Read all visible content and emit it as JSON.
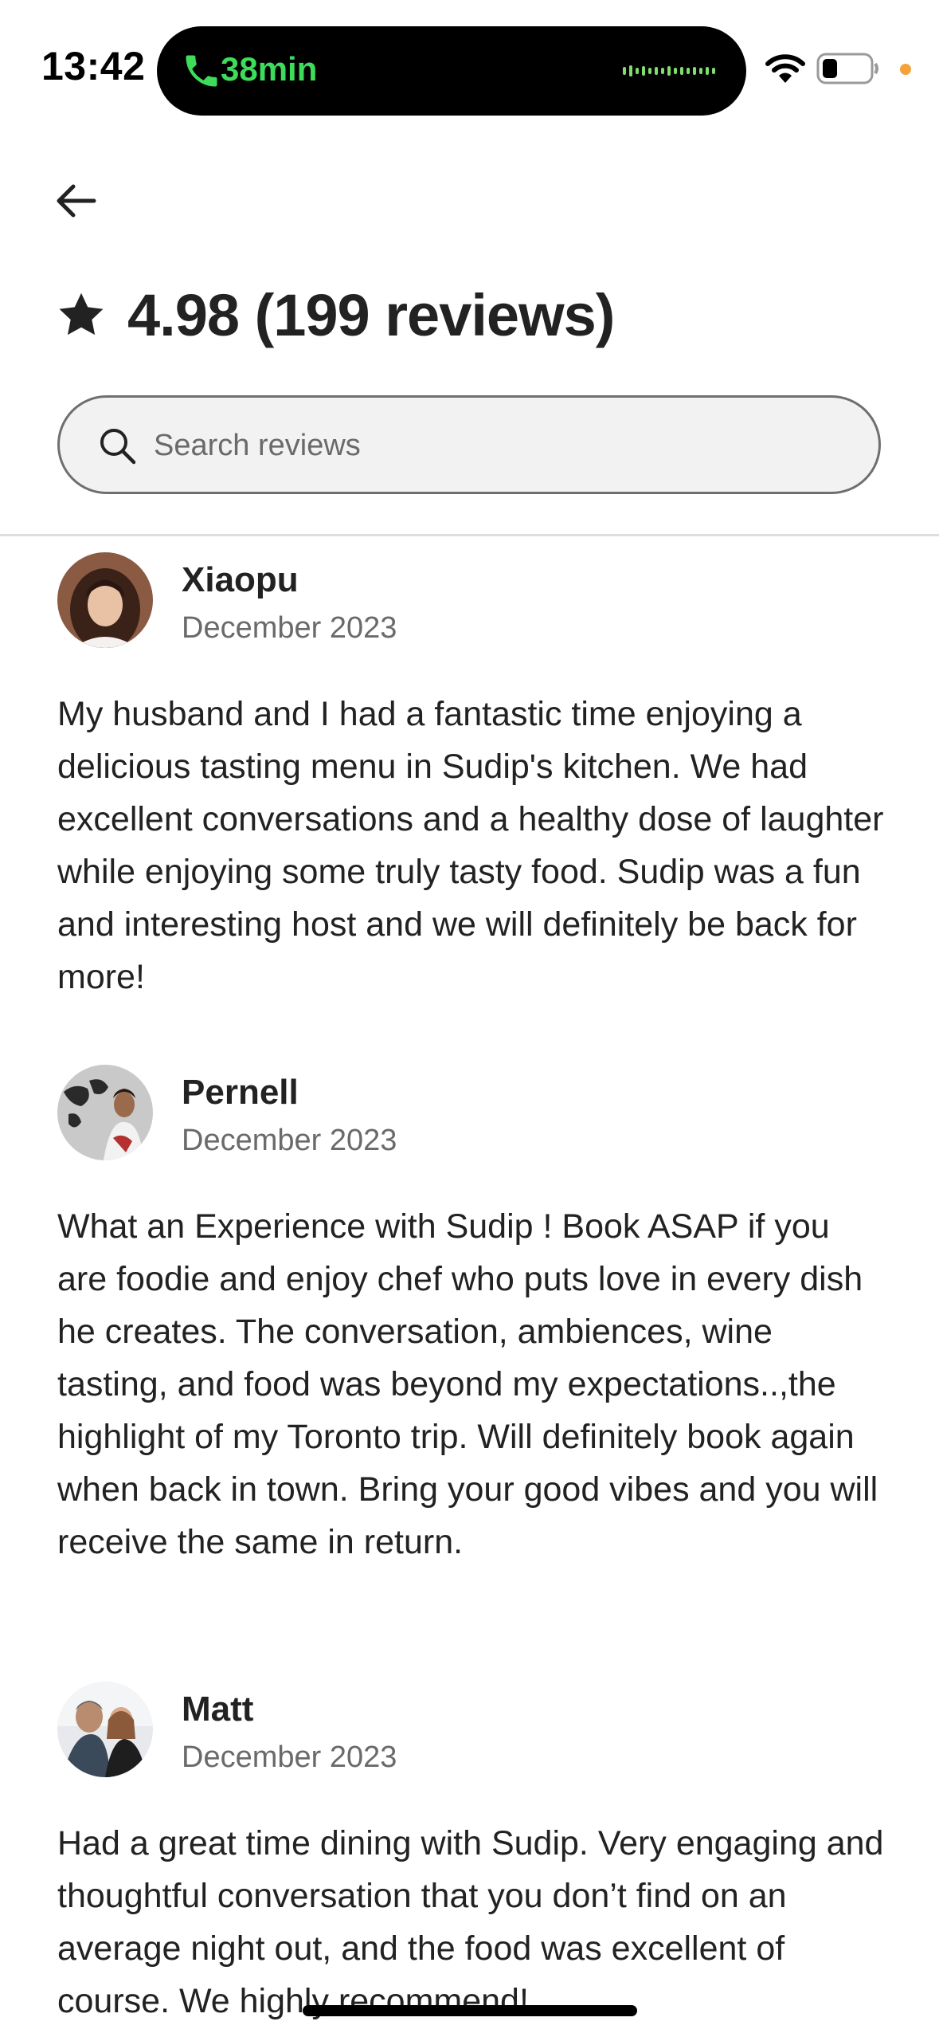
{
  "status_bar": {
    "time": "13:42",
    "call_duration": "38min",
    "call_color": "#3ddc5a"
  },
  "header": {
    "back_icon": "arrow-left-icon",
    "rating_icon": "star-icon",
    "rating_title": "4.98 (199 reviews)"
  },
  "search": {
    "icon": "search-icon",
    "placeholder": "Search reviews",
    "value": ""
  },
  "reviews": [
    {
      "name": "Xiaopu",
      "date": "December 2023",
      "text": "My husband and I had a fantastic time enjoying a delicious tasting menu in Sudip's kitchen. We had excellent conversations and a  healthy dose of laughter while enjoying some truly tasty food. Sudip was a fun and interesting host and we will definitely be back for more!"
    },
    {
      "name": "Pernell",
      "date": "December 2023",
      "text": "What an Experience with Sudip ! Book ASAP if you are foodie and enjoy chef who puts love in every dish he creates. The conversation, ambiences, wine tasting, and food was beyond my expectations..,the highlight of my Toronto trip. Will definitely book again when back in town. Bring your good vibes and you will receive the same in return."
    },
    {
      "name": "Matt",
      "date": "December 2023",
      "text": "Had a great time dining with Sudip.  Very engaging and thoughtful conversation that you don’t find on an average night out, and the food was excellent of course. We highly recommend!"
    }
  ],
  "colors": {
    "text_primary": "#222222",
    "text_secondary": "#6a6a6a",
    "search_background": "#f2f2f2",
    "divider": "#dddddd"
  }
}
